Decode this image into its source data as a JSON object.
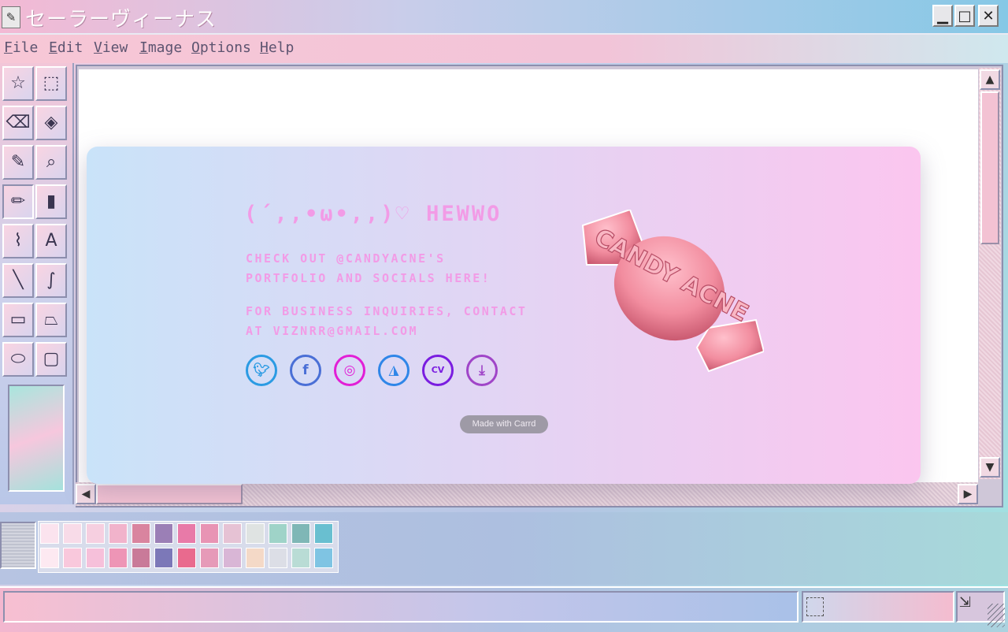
{
  "window": {
    "title": "セーラーヴィーナス",
    "icon": "paint-app-icon",
    "controls": {
      "minimize": "▁",
      "maximize": "□",
      "close": "✕"
    }
  },
  "menu": [
    "File",
    "Edit",
    "View",
    "Image",
    "Options",
    "Help"
  ],
  "tools": [
    {
      "name": "free-select-icon",
      "glyph": "☆"
    },
    {
      "name": "rect-select-icon",
      "glyph": "⬚"
    },
    {
      "name": "eraser-icon",
      "glyph": "⌫"
    },
    {
      "name": "fill-bucket-icon",
      "glyph": "◈"
    },
    {
      "name": "eyedropper-icon",
      "glyph": "✎"
    },
    {
      "name": "magnifier-icon",
      "glyph": "⌕"
    },
    {
      "name": "pencil-icon",
      "glyph": "✏"
    },
    {
      "name": "brush-icon",
      "glyph": "▮"
    },
    {
      "name": "airbrush-icon",
      "glyph": "⌇"
    },
    {
      "name": "text-icon",
      "glyph": "A"
    },
    {
      "name": "line-icon",
      "glyph": "╲"
    },
    {
      "name": "curve-icon",
      "glyph": "∫"
    },
    {
      "name": "rectangle-icon",
      "glyph": "▭"
    },
    {
      "name": "polygon-icon",
      "glyph": "⏢"
    },
    {
      "name": "ellipse-icon",
      "glyph": "⬭"
    },
    {
      "name": "rounded-rect-icon",
      "glyph": "▢"
    }
  ],
  "card": {
    "hello": "(´,,•ω•,,)♡ HEWWO",
    "line1": "CHECK OUT @CANDYACNE'S",
    "line2": "PORTFOLIO AND SOCIALS HERE!",
    "line3": "FOR BUSINESS INQUIRIES, CONTACT",
    "line4": "AT VIZNRR@GMAIL.COM",
    "candy_logo": "CANDY ACNE",
    "made_with": "Made with Carrd",
    "socials": [
      {
        "name": "twitter-icon",
        "glyph": "🐦︎",
        "color": "#2b9be3"
      },
      {
        "name": "facebook-icon",
        "glyph": "f",
        "color": "#4a6fd6"
      },
      {
        "name": "instagram-icon",
        "glyph": "◎",
        "color": "#e21fd6"
      },
      {
        "name": "artstation-icon",
        "glyph": "◮",
        "color": "#2f86e8"
      },
      {
        "name": "cv-icon",
        "glyph": "CV",
        "color": "#7a1de0"
      },
      {
        "name": "download-icon",
        "glyph": "⤓",
        "color": "#a045c8"
      }
    ]
  },
  "palette": [
    [
      "#fbe3ee",
      "#f8dbe8",
      "#f6cfe0",
      "#f1b3cb",
      "#d9849f",
      "#9b7fb6",
      "#e87aa8",
      "#e894b4",
      "#e6c2d4",
      "#dfe3e2",
      "#9fd3c8",
      "#7fb7b6",
      "#69bfd0"
    ],
    [
      "#fde9f1",
      "#f9c8dc",
      "#f6c0da",
      "#ee95b6",
      "#c97a99",
      "#7c78b8",
      "#e96a8e",
      "#e69ab8",
      "#d9b6d6",
      "#f4d9c7",
      "#dcdee6",
      "#b9dcd5",
      "#7fc4e3"
    ]
  ]
}
